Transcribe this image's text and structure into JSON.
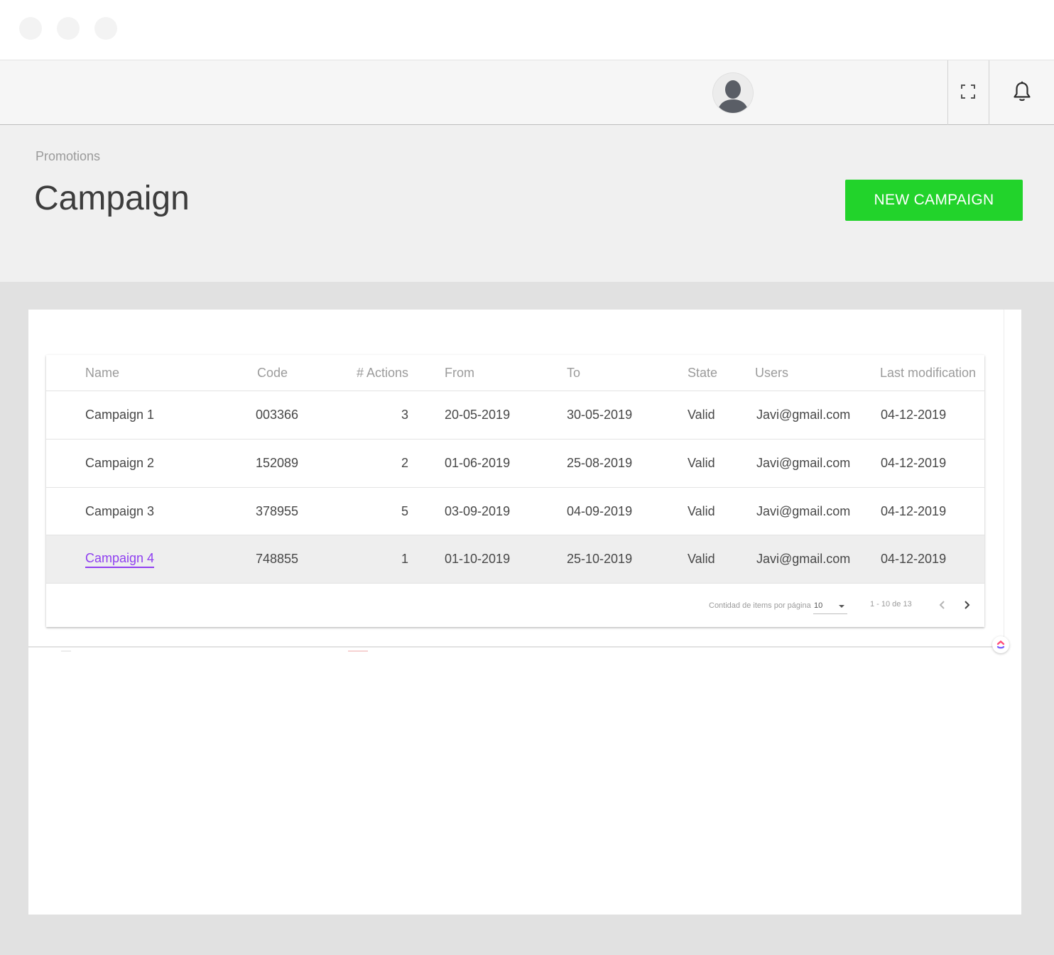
{
  "breadcrumb": "Promotions",
  "page_title": "Campaign",
  "new_button_label": "NEW CAMPAIGN",
  "colors": {
    "primary_button": "#22d32b",
    "link": "#8f3ff0"
  },
  "icons": {
    "avatar": "user-avatar-icon",
    "fullscreen": "fullscreen-icon",
    "notifications": "bell-icon",
    "prev": "chevron-left-icon",
    "next": "chevron-right-icon"
  },
  "table": {
    "columns": [
      "Name",
      "Code",
      "# Actions",
      "From",
      "To",
      "State",
      "Users",
      "Last modification"
    ],
    "rows": [
      {
        "name": "Campaign 1",
        "code": "003366",
        "actions": "3",
        "from": "20-05-2019",
        "to": "30-05-2019",
        "state": "Valid",
        "users": "Javi@gmail.com",
        "last": "04-12-2019"
      },
      {
        "name": "Campaign 2",
        "code": "152089",
        "actions": "2",
        "from": "01-06-2019",
        "to": "25-08-2019",
        "state": "Valid",
        "users": "Javi@gmail.com",
        "last": "04-12-2019"
      },
      {
        "name": "Campaign 3",
        "code": "378955",
        "actions": "5",
        "from": "03-09-2019",
        "to": "04-09-2019",
        "state": "Valid",
        "users": "Javi@gmail.com",
        "last": "04-12-2019"
      },
      {
        "name": "Campaign  4",
        "code": "748855",
        "actions": "1",
        "from": "01-10-2019",
        "to": "25-10-2019",
        "state": "Valid",
        "users": "Javi@gmail.com",
        "last": "04-12-2019"
      }
    ]
  },
  "paginator": {
    "items_per_page_label": "Contidad de items por página",
    "items_per_page_value": "10",
    "range_label": "1 - 10 de 13"
  }
}
